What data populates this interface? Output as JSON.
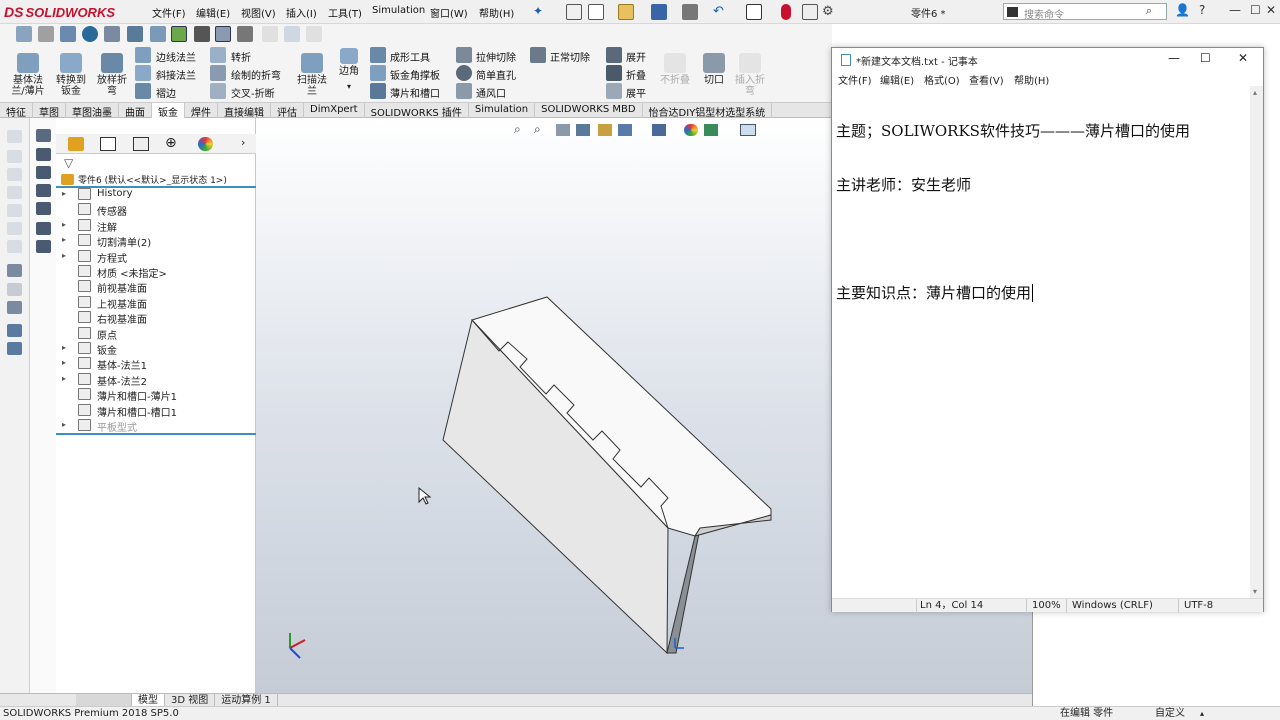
{
  "app": {
    "brand": "SOLIDWORKS",
    "brand_mark": "DS",
    "doc_title": "零件6 *",
    "search_placeholder": "搜索命令"
  },
  "menu": [
    "文件(F)",
    "编辑(E)",
    "视图(V)",
    "插入(I)",
    "工具(T)",
    "Simulation",
    "窗口(W)",
    "帮助(H)"
  ],
  "window_controls": {
    "min": "—",
    "max": "☐",
    "close": "✕",
    "help": "?",
    "user": "👤"
  },
  "commands": {
    "big": [
      {
        "label1": "基体法",
        "label2": "兰/薄片"
      },
      {
        "label1": "转换到",
        "label2": "钣金"
      },
      {
        "label1": "放样折",
        "label2": "弯"
      }
    ],
    "col1": [
      "边线法兰",
      "斜接法兰",
      "褶边"
    ],
    "col1b": [
      "转折",
      "绘制的折弯",
      "交叉-折断"
    ],
    "sweep": {
      "label1": "扫描法",
      "label2": "兰"
    },
    "corner": "边角",
    "col2": [
      "成形工具",
      "钣金角撑板",
      "薄片和槽口"
    ],
    "col3": [
      "拉伸切除",
      "简单直孔",
      "通风口"
    ],
    "col3b": [
      "正常切除"
    ],
    "col4": [
      "展开",
      "折叠",
      "展平"
    ],
    "nofold": "不折叠",
    "cut": "切口",
    "insert_bend": {
      "label1": "插入折",
      "label2": "弯"
    }
  },
  "tabs": [
    "特征",
    "草图",
    "草图油墨",
    "曲面",
    "钣金",
    "焊件",
    "直接编辑",
    "评估",
    "DimXpert",
    "SOLIDWORKS 插件",
    "Simulation",
    "SOLIDWORKS MBD",
    "怡合达DIY铝型材选型系统"
  ],
  "active_tab": "钣金",
  "tree": {
    "root": "零件6 (默认<<默认>_显示状态 1>)",
    "items": [
      {
        "label": "History",
        "arrow": "▸"
      },
      {
        "label": "传感器",
        "arrow": ""
      },
      {
        "label": "注解",
        "arrow": "▸"
      },
      {
        "label": "切割清单(2)",
        "arrow": "▸"
      },
      {
        "label": "方程式",
        "arrow": "▸"
      },
      {
        "label": "材质 <未指定>",
        "arrow": ""
      },
      {
        "label": "前视基准面",
        "arrow": ""
      },
      {
        "label": "上视基准面",
        "arrow": ""
      },
      {
        "label": "右视基准面",
        "arrow": ""
      },
      {
        "label": "原点",
        "arrow": ""
      },
      {
        "label": "钣金",
        "arrow": "▸"
      },
      {
        "label": "基体-法兰1",
        "arrow": "▸"
      },
      {
        "label": "基体-法兰2",
        "arrow": "▸"
      },
      {
        "label": "薄片和槽口-薄片1",
        "arrow": ""
      },
      {
        "label": "薄片和槽口-槽口1",
        "arrow": ""
      },
      {
        "label": "平板型式",
        "arrow": "▸"
      }
    ]
  },
  "bottom_tabs": [
    "模型",
    "3D 视图",
    "运动算例 1"
  ],
  "status": {
    "left": "SOLIDWORKS Premium 2018 SP5.0",
    "editing": "在编辑 零件",
    "custom": "自定义"
  },
  "notepad": {
    "title": "*新建文本文档.txt - 记事本",
    "menu": [
      "文件(F)",
      "编辑(E)",
      "格式(O)",
      "查看(V)",
      "帮助(H)"
    ],
    "lines": [
      "主题；SOLIWORKS软件技巧———薄片槽口的使用",
      "主讲老师：安生老师",
      "",
      "主要知识点：薄片槽口的使用"
    ],
    "status": {
      "pos": "Ln 4，Col 14",
      "zoom": "100%",
      "eol": "Windows (CRLF)",
      "enc": "UTF-8"
    }
  },
  "colors": {
    "brand_red": "#c8102e",
    "tree_accent": "#3a8fc2",
    "part_face": "#e8e8e8",
    "part_top": "#f9f9f9"
  }
}
